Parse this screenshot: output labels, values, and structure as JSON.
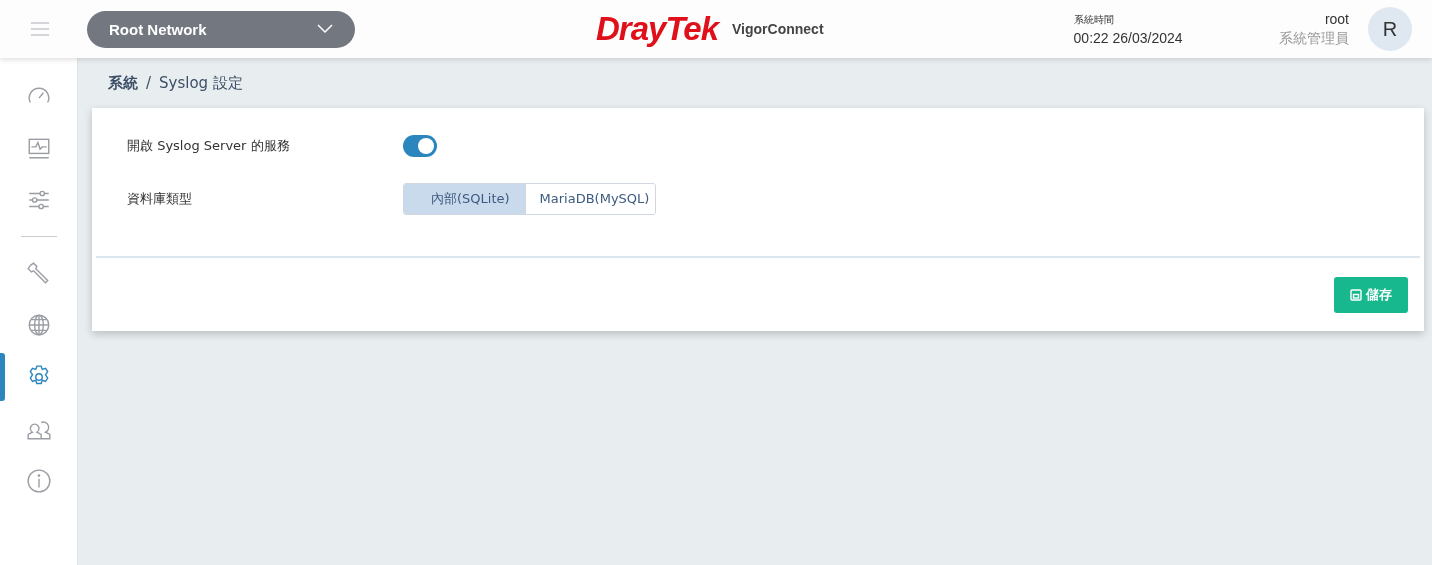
{
  "header": {
    "network_selector": {
      "value": "Root Network"
    },
    "logo": {
      "brand": "DrayTek",
      "product": "VigorConnect"
    },
    "clock": {
      "label": "系統時間",
      "value": "00:22 26/03/2024"
    },
    "user": {
      "name": "root",
      "role": "系統管理員",
      "avatar_initial": "R"
    }
  },
  "sidebar": {
    "groups": [
      {
        "items": [
          {
            "selected": false
          },
          {
            "selected": false
          },
          {
            "selected": false
          }
        ]
      },
      {
        "items": [
          {
            "selected": false
          },
          {
            "selected": false
          },
          {
            "selected": true
          },
          {
            "selected": false
          },
          {
            "selected": false
          }
        ]
      }
    ]
  },
  "breadcrumb": {
    "separator": "/",
    "items": [
      {
        "text": "系統",
        "current": false
      },
      {
        "text": "Syslog 設定",
        "current": true
      }
    ]
  },
  "form": {
    "syslog_service": {
      "label": "開啟 Syslog Server 的服務",
      "on": true
    },
    "database_type": {
      "label": "資料庫類型",
      "options": [
        {
          "label": "內部(SQLite)",
          "selected": true
        },
        {
          "label": "MariaDB(MySQL)",
          "selected": false
        }
      ]
    },
    "save_button": {
      "label": "儲存"
    }
  }
}
